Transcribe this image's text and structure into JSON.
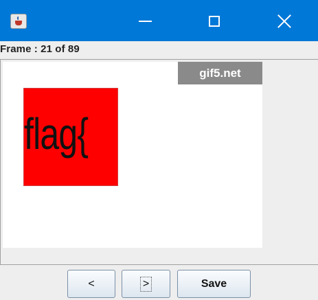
{
  "window": {
    "app_icon": "java-cup-icon",
    "controls": {
      "minimize_icon": "minimize-icon",
      "maximize_icon": "maximize-icon",
      "close_icon": "close-icon"
    },
    "accent_color": "#0078d7"
  },
  "frame_info": {
    "label": "Frame : 21 of 89"
  },
  "viewer": {
    "watermark": "gif5.net",
    "content_text": "flag{",
    "content_background": "#ff0000"
  },
  "buttons": {
    "prev_label": "<",
    "next_label": ">",
    "save_label": "Save"
  }
}
